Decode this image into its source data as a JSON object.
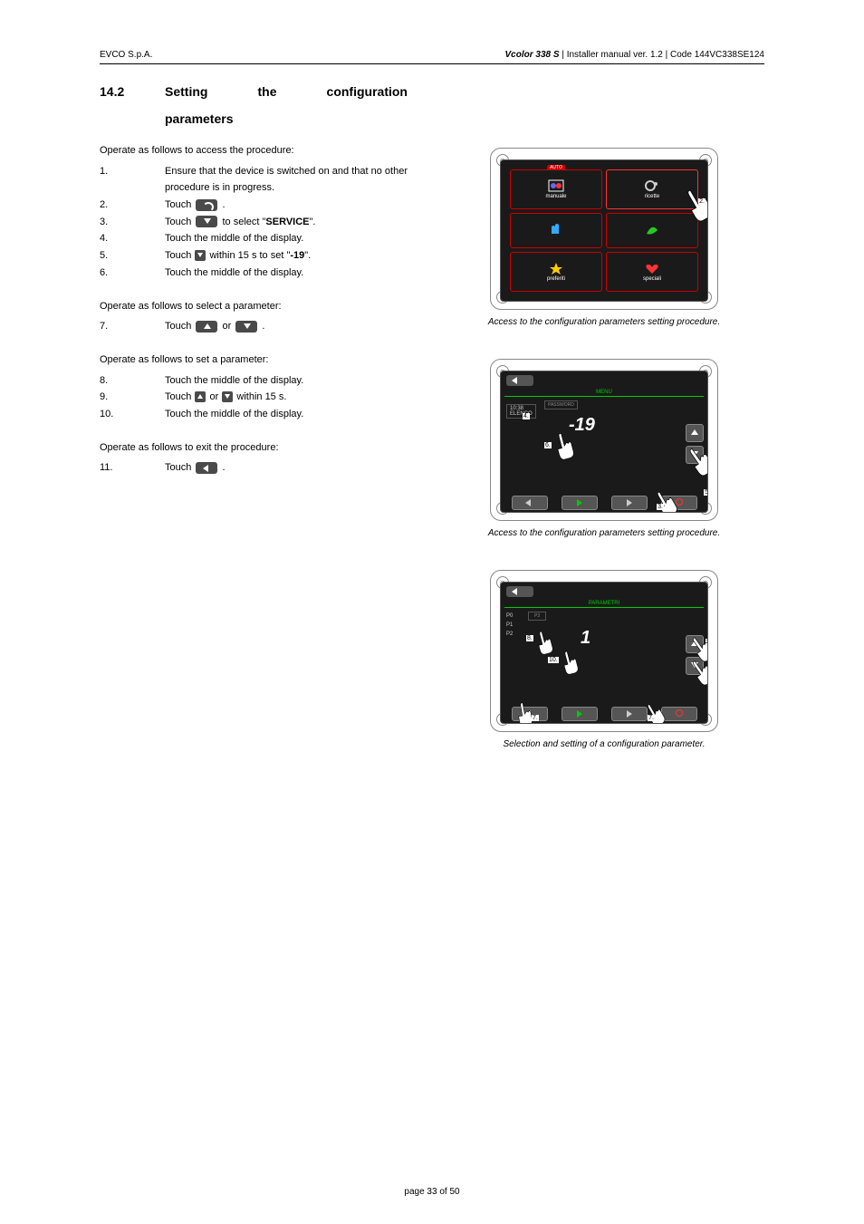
{
  "header": {
    "left": "EVCO S.p.A.",
    "right_product": "Vcolor 338 S",
    "right_rest": " | Installer manual ver. 1.2 | Code 144VC338SE124"
  },
  "section": {
    "number": "14.2",
    "title_w1": "Setting",
    "title_w2": "the",
    "title_w3": "configuration",
    "title_line2": "parameters"
  },
  "intro1": "Operate as follows to access the procedure:",
  "steps_a": [
    {
      "n": "1.",
      "t": "Ensure that the device is switched on and that no other procedure is in progress."
    },
    {
      "n": "2.",
      "pre": "Touch ",
      "icon": "wrench",
      "post": " ."
    },
    {
      "n": "3.",
      "pre": "Touch ",
      "icon": "down",
      "mid": " to select \"",
      "b": "SERVICE",
      "post": "\"."
    },
    {
      "n": "4.",
      "t": "Touch the middle of the display."
    },
    {
      "n": "5.",
      "pre": "Touch ",
      "sicon": "down",
      "mid": " within 15 s to set \"",
      "b": "-19",
      "post": "\"."
    },
    {
      "n": "6.",
      "t": "Touch the middle of the display."
    }
  ],
  "intro2": "Operate as follows to select a parameter:",
  "steps_b": [
    {
      "n": "7.",
      "pre": "Touch ",
      "icon": "up",
      "mid": " or ",
      "icon2": "down",
      "post": " ."
    }
  ],
  "intro3": "Operate as follows to set a parameter:",
  "steps_c": [
    {
      "n": "8.",
      "t": "Touch the middle of the display."
    },
    {
      "n": "9.",
      "pre": "Touch ",
      "sicon": "up",
      "mid": " or ",
      "sicon2": "down",
      "post": " within 15 s."
    },
    {
      "n": "10.",
      "t": "Touch the middle of the display."
    }
  ],
  "intro4": "Operate as follows to exit the procedure:",
  "steps_d": [
    {
      "n": "11.",
      "pre": "Touch ",
      "icon": "back",
      "post": " ."
    }
  ],
  "fig1": {
    "tile_tab": "AUTO",
    "tiles": [
      "manuale",
      "ricette",
      "",
      "",
      "preferiti",
      "speciali"
    ],
    "callout": "2.",
    "caption": "Access to the configuration parameters setting procedure."
  },
  "fig2": {
    "menu": "MENU",
    "leftbox_top": "10:38",
    "leftbox_bot": "ELENCO",
    "password": "PASSWORD",
    "value": "-19",
    "callouts": {
      "c3": "3.",
      "c4": "4.",
      "c5": "5.",
      "c6": "6."
    },
    "caption": "Access to the configuration parameters setting procedure."
  },
  "fig3": {
    "menu": "PARAMETRI",
    "rows": [
      "P0",
      "P1",
      "P2"
    ],
    "box": "P3",
    "value": "1",
    "callouts": {
      "c7": "7.",
      "c8": "8.",
      "c9": "9.",
      "c10": "10."
    },
    "caption": "Selection and setting of a configuration parameter."
  },
  "footer": "page 33 of 50"
}
